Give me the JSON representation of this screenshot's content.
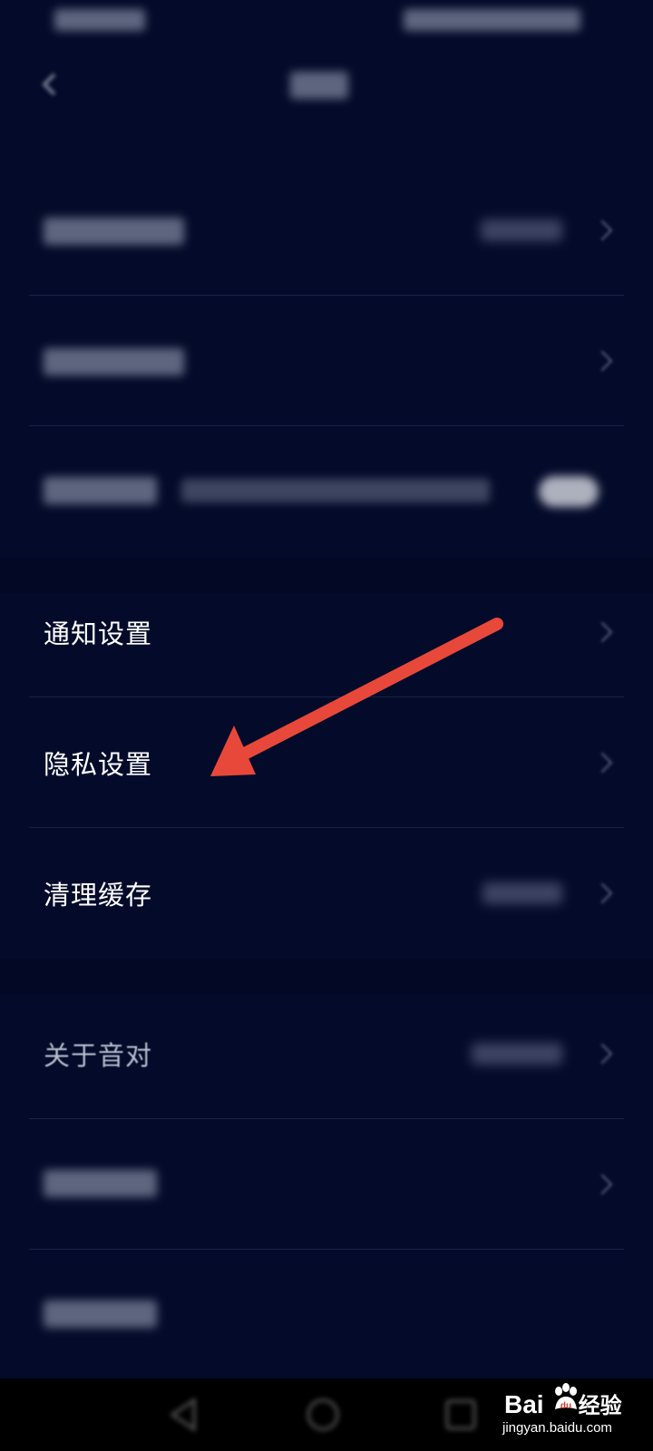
{
  "settings": {
    "items": [
      {
        "label": "通知设置"
      },
      {
        "label": "隐私设置"
      },
      {
        "label": "清理缓存"
      },
      {
        "label": "关于音对"
      }
    ]
  },
  "watermark": {
    "brand_left": "Bai",
    "brand_right": "经验",
    "url": "jingyan.baidu.com"
  },
  "colors": {
    "background": "#040b2a",
    "arrow": "#e8483a",
    "text": "#ffffff"
  },
  "icons": {
    "back": "chevron-left-icon",
    "row": "chevron-right-icon",
    "annotation": "arrow-icon"
  }
}
